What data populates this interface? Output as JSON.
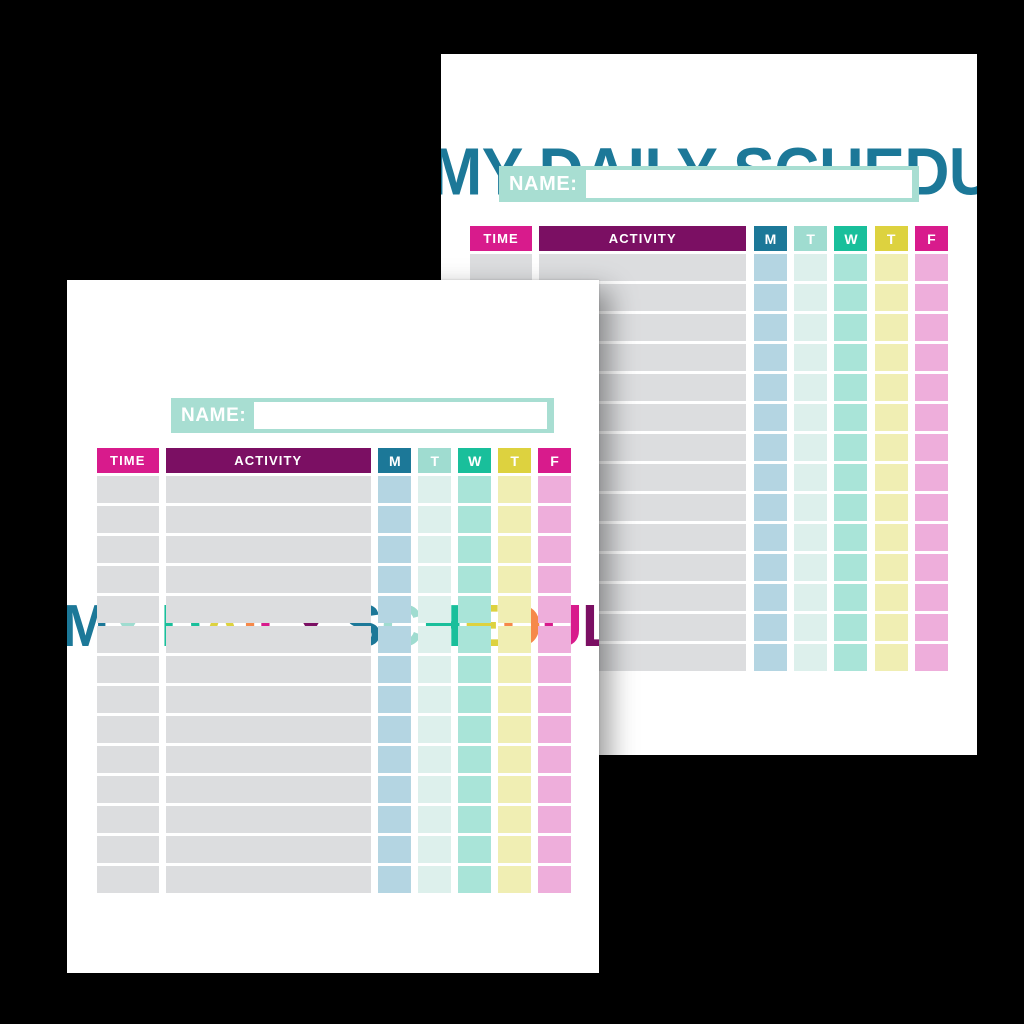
{
  "document": {
    "kind": "printable-planner",
    "background_color": "#000000",
    "sheet_color": "#ffffff"
  },
  "palette": {
    "teal_blue": "#1c7898",
    "mint_light": "#9fdcd0",
    "green_teal": "#19bf9b",
    "yellow": "#ddd23f",
    "orange": "#f6894a",
    "magenta": "#d81b8c",
    "purple_deep": "#7b0f63",
    "name_bar": "#a8ded2",
    "body_gray": "#dcdddf",
    "pastel_mon": "#b4d5e2",
    "pastel_tue": "#ddf0ec",
    "pastel_wed": "#a9e4d8",
    "pastel_thu": "#f0eeb3",
    "pastel_fri": "#eeaedb"
  },
  "sheets": [
    {
      "id": "back-sheet",
      "title": {
        "text": "MY DAILY SCHEDULE",
        "style": "single-color",
        "color": "#1c7898"
      },
      "name_field": {
        "label": "NAME:",
        "value": "",
        "placeholder": ""
      },
      "table": {
        "headers": [
          {
            "key": "time",
            "label": "TIME",
            "bg": "#d81b8c",
            "fg": "#ffffff"
          },
          {
            "key": "activity",
            "label": "ACTIVITY",
            "bg": "#7b0f63",
            "fg": "#ffffff"
          },
          {
            "key": "mon",
            "label": "M",
            "bg": "#1c7898",
            "fg": "#ffffff"
          },
          {
            "key": "tue",
            "label": "T",
            "bg": "#9fdcd0",
            "fg": "#ffffff"
          },
          {
            "key": "wed",
            "label": "W",
            "bg": "#19bf9b",
            "fg": "#ffffff"
          },
          {
            "key": "thu",
            "label": "T",
            "bg": "#ddd23f",
            "fg": "#ffffff"
          },
          {
            "key": "fri",
            "label": "F",
            "bg": "#d81b8c",
            "fg": "#ffffff"
          }
        ],
        "row_count": 14,
        "rows": [
          {
            "time": "",
            "activity": "",
            "mon": "",
            "tue": "",
            "wed": "",
            "thu": "",
            "fri": ""
          },
          {
            "time": "",
            "activity": "",
            "mon": "",
            "tue": "",
            "wed": "",
            "thu": "",
            "fri": ""
          },
          {
            "time": "",
            "activity": "",
            "mon": "",
            "tue": "",
            "wed": "",
            "thu": "",
            "fri": ""
          },
          {
            "time": "",
            "activity": "",
            "mon": "",
            "tue": "",
            "wed": "",
            "thu": "",
            "fri": ""
          },
          {
            "time": "",
            "activity": "",
            "mon": "",
            "tue": "",
            "wed": "",
            "thu": "",
            "fri": ""
          },
          {
            "time": "",
            "activity": "",
            "mon": "",
            "tue": "",
            "wed": "",
            "thu": "",
            "fri": ""
          },
          {
            "time": "",
            "activity": "",
            "mon": "",
            "tue": "",
            "wed": "",
            "thu": "",
            "fri": ""
          },
          {
            "time": "",
            "activity": "",
            "mon": "",
            "tue": "",
            "wed": "",
            "thu": "",
            "fri": ""
          },
          {
            "time": "",
            "activity": "",
            "mon": "",
            "tue": "",
            "wed": "",
            "thu": "",
            "fri": ""
          },
          {
            "time": "",
            "activity": "",
            "mon": "",
            "tue": "",
            "wed": "",
            "thu": "",
            "fri": ""
          },
          {
            "time": "",
            "activity": "",
            "mon": "",
            "tue": "",
            "wed": "",
            "thu": "",
            "fri": ""
          },
          {
            "time": "",
            "activity": "",
            "mon": "",
            "tue": "",
            "wed": "",
            "thu": "",
            "fri": ""
          },
          {
            "time": "",
            "activity": "",
            "mon": "",
            "tue": "",
            "wed": "",
            "thu": "",
            "fri": ""
          },
          {
            "time": "",
            "activity": "",
            "mon": "",
            "tue": "",
            "wed": "",
            "thu": "",
            "fri": ""
          }
        ]
      }
    },
    {
      "id": "front-sheet",
      "title": {
        "text": "MY DAILY SCHEDULE",
        "style": "multi-color",
        "letters": [
          {
            "ch": "M",
            "color": "#1c7898"
          },
          {
            "ch": "Y",
            "color": "#9fdcd0"
          },
          {
            "ch": " ",
            "color": "transparent"
          },
          {
            "ch": "D",
            "color": "#19bf9b"
          },
          {
            "ch": "A",
            "color": "#ddd23f"
          },
          {
            "ch": "I",
            "color": "#f6894a"
          },
          {
            "ch": "L",
            "color": "#d81b8c"
          },
          {
            "ch": "Y",
            "color": "#7b0f63"
          },
          {
            "ch": " ",
            "color": "transparent"
          },
          {
            "ch": "S",
            "color": "#1c7898"
          },
          {
            "ch": "C",
            "color": "#9fdcd0"
          },
          {
            "ch": "H",
            "color": "#19bf9b"
          },
          {
            "ch": "E",
            "color": "#ddd23f"
          },
          {
            "ch": "D",
            "color": "#f6894a"
          },
          {
            "ch": "U",
            "color": "#d81b8c"
          },
          {
            "ch": "L",
            "color": "#7b0f63"
          },
          {
            "ch": "E",
            "color": "#1c7898"
          }
        ]
      },
      "name_field": {
        "label": "NAME:",
        "value": "",
        "placeholder": ""
      },
      "table": {
        "headers": [
          {
            "key": "time",
            "label": "TIME",
            "bg": "#d81b8c",
            "fg": "#ffffff"
          },
          {
            "key": "activity",
            "label": "ACTIVITY",
            "bg": "#7b0f63",
            "fg": "#ffffff"
          },
          {
            "key": "mon",
            "label": "M",
            "bg": "#1c7898",
            "fg": "#ffffff"
          },
          {
            "key": "tue",
            "label": "T",
            "bg": "#9fdcd0",
            "fg": "#ffffff"
          },
          {
            "key": "wed",
            "label": "W",
            "bg": "#19bf9b",
            "fg": "#ffffff"
          },
          {
            "key": "thu",
            "label": "T",
            "bg": "#ddd23f",
            "fg": "#ffffff"
          },
          {
            "key": "fri",
            "label": "F",
            "bg": "#d81b8c",
            "fg": "#ffffff"
          }
        ],
        "row_count": 14,
        "rows": [
          {
            "time": "",
            "activity": "",
            "mon": "",
            "tue": "",
            "wed": "",
            "thu": "",
            "fri": ""
          },
          {
            "time": "",
            "activity": "",
            "mon": "",
            "tue": "",
            "wed": "",
            "thu": "",
            "fri": ""
          },
          {
            "time": "",
            "activity": "",
            "mon": "",
            "tue": "",
            "wed": "",
            "thu": "",
            "fri": ""
          },
          {
            "time": "",
            "activity": "",
            "mon": "",
            "tue": "",
            "wed": "",
            "thu": "",
            "fri": ""
          },
          {
            "time": "",
            "activity": "",
            "mon": "",
            "tue": "",
            "wed": "",
            "thu": "",
            "fri": ""
          },
          {
            "time": "",
            "activity": "",
            "mon": "",
            "tue": "",
            "wed": "",
            "thu": "",
            "fri": ""
          },
          {
            "time": "",
            "activity": "",
            "mon": "",
            "tue": "",
            "wed": "",
            "thu": "",
            "fri": ""
          },
          {
            "time": "",
            "activity": "",
            "mon": "",
            "tue": "",
            "wed": "",
            "thu": "",
            "fri": ""
          },
          {
            "time": "",
            "activity": "",
            "mon": "",
            "tue": "",
            "wed": "",
            "thu": "",
            "fri": ""
          },
          {
            "time": "",
            "activity": "",
            "mon": "",
            "tue": "",
            "wed": "",
            "thu": "",
            "fri": ""
          },
          {
            "time": "",
            "activity": "",
            "mon": "",
            "tue": "",
            "wed": "",
            "thu": "",
            "fri": ""
          },
          {
            "time": "",
            "activity": "",
            "mon": "",
            "tue": "",
            "wed": "",
            "thu": "",
            "fri": ""
          },
          {
            "time": "",
            "activity": "",
            "mon": "",
            "tue": "",
            "wed": "",
            "thu": "",
            "fri": ""
          },
          {
            "time": "",
            "activity": "",
            "mon": "",
            "tue": "",
            "wed": "",
            "thu": "",
            "fri": ""
          }
        ]
      }
    }
  ]
}
